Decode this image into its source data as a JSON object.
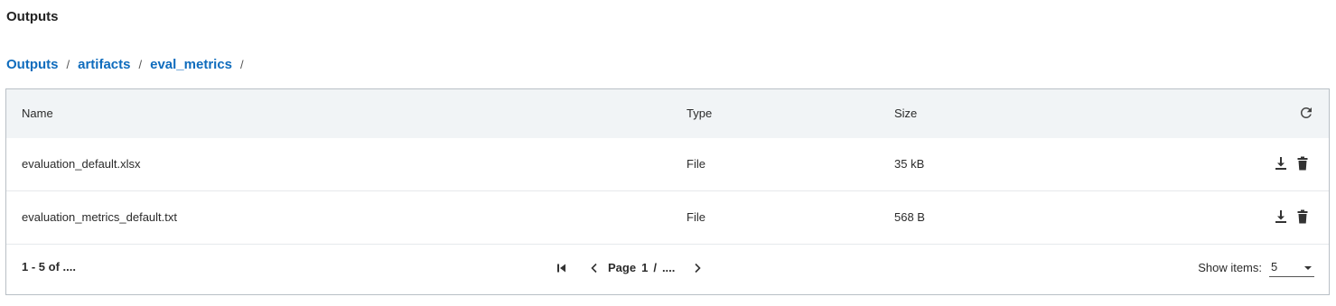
{
  "page": {
    "title": "Outputs"
  },
  "breadcrumb": {
    "items": [
      {
        "label": "Outputs"
      },
      {
        "label": "artifacts"
      },
      {
        "label": "eval_metrics"
      }
    ],
    "separator": "/"
  },
  "table": {
    "columns": {
      "name": "Name",
      "type": "Type",
      "size": "Size"
    },
    "rows": [
      {
        "name": "evaluation_default.xlsx",
        "type": "File",
        "size": "35 kB"
      },
      {
        "name": "evaluation_metrics_default.txt",
        "type": "File",
        "size": "568 B"
      }
    ],
    "icons": {
      "refresh": "refresh-icon",
      "download": "download-icon",
      "delete": "trash-icon"
    }
  },
  "footer": {
    "range": "1 - 5 of ....",
    "pager": {
      "page_label": "Page",
      "current": "1",
      "slash": "/",
      "total": "...."
    },
    "show_items_label": "Show items:",
    "show_items_value": "5"
  },
  "colors": {
    "link": "#0f6cbd",
    "header_bg": "#f1f4f6",
    "border": "#b9c0c6"
  }
}
